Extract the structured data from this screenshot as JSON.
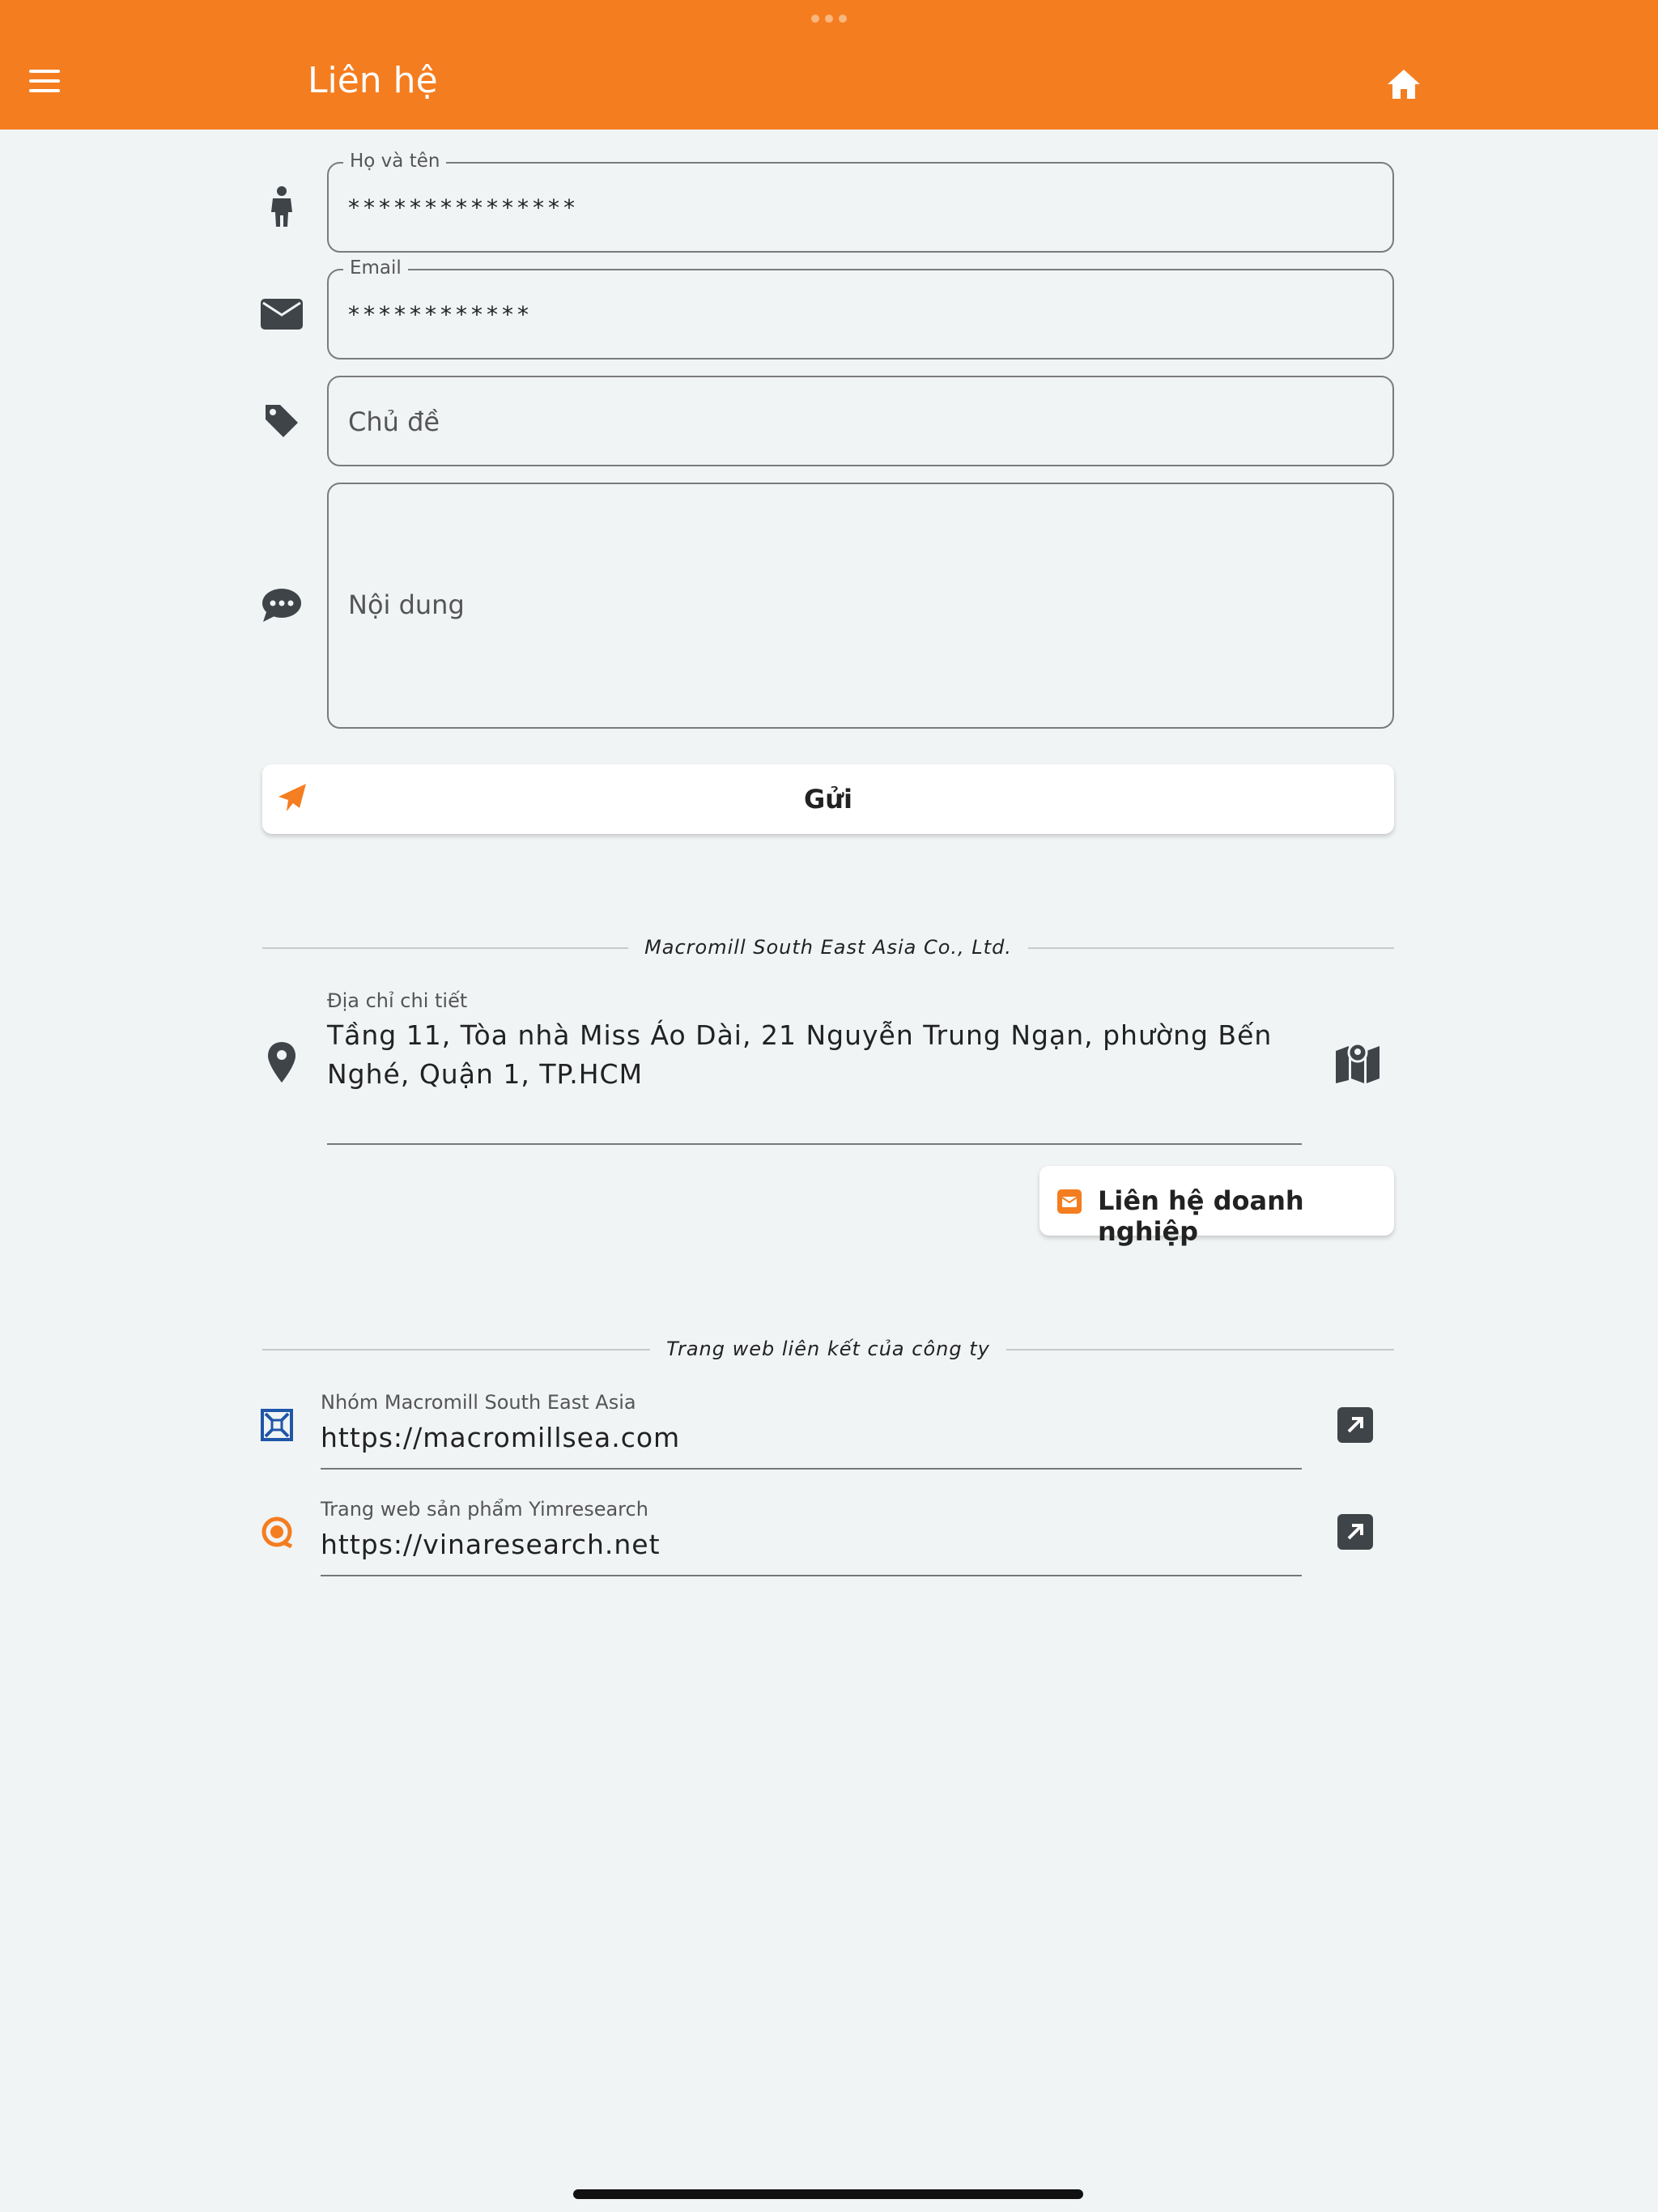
{
  "appbar": {
    "title": "Liên hệ",
    "color": "#f47d20"
  },
  "form": {
    "name": {
      "label": "Họ và tên",
      "value": "***************"
    },
    "email": {
      "label": "Email",
      "value": "************"
    },
    "subject": {
      "placeholder": "Chủ đề"
    },
    "content": {
      "placeholder": "Nội dung"
    },
    "send_label": "Gửi"
  },
  "company": {
    "name": "Macromill South East Asia Co., Ltd.",
    "address_label": "Địa chỉ chi tiết",
    "address": "Tầng 11, Tòa nhà Miss Áo Dài, 21 Nguyễn Trung Ngạn, phường Bến Nghé, Quận 1, TP.HCM",
    "business_contact_label": "Liên hệ doanh nghiệp"
  },
  "links_section": {
    "title": "Trang web liên kết của công ty",
    "items": [
      {
        "label": "Nhóm Macromill South East Asia",
        "url": "https://macromillsea.com",
        "icon": "macromill-logo-icon"
      },
      {
        "label": "Trang web sản phẩm Yimresearch",
        "url": "https://vinaresearch.net",
        "icon": "vinaresearch-logo-icon"
      }
    ]
  },
  "icons": {
    "menu": "menu-icon",
    "home": "home-icon",
    "person": "person-icon",
    "email": "envelope-icon",
    "tag": "tag-icon",
    "chat": "chat-bubble-icon",
    "send": "paper-plane-icon",
    "location": "map-pin-icon",
    "map": "map-icon",
    "external": "external-link-icon"
  }
}
